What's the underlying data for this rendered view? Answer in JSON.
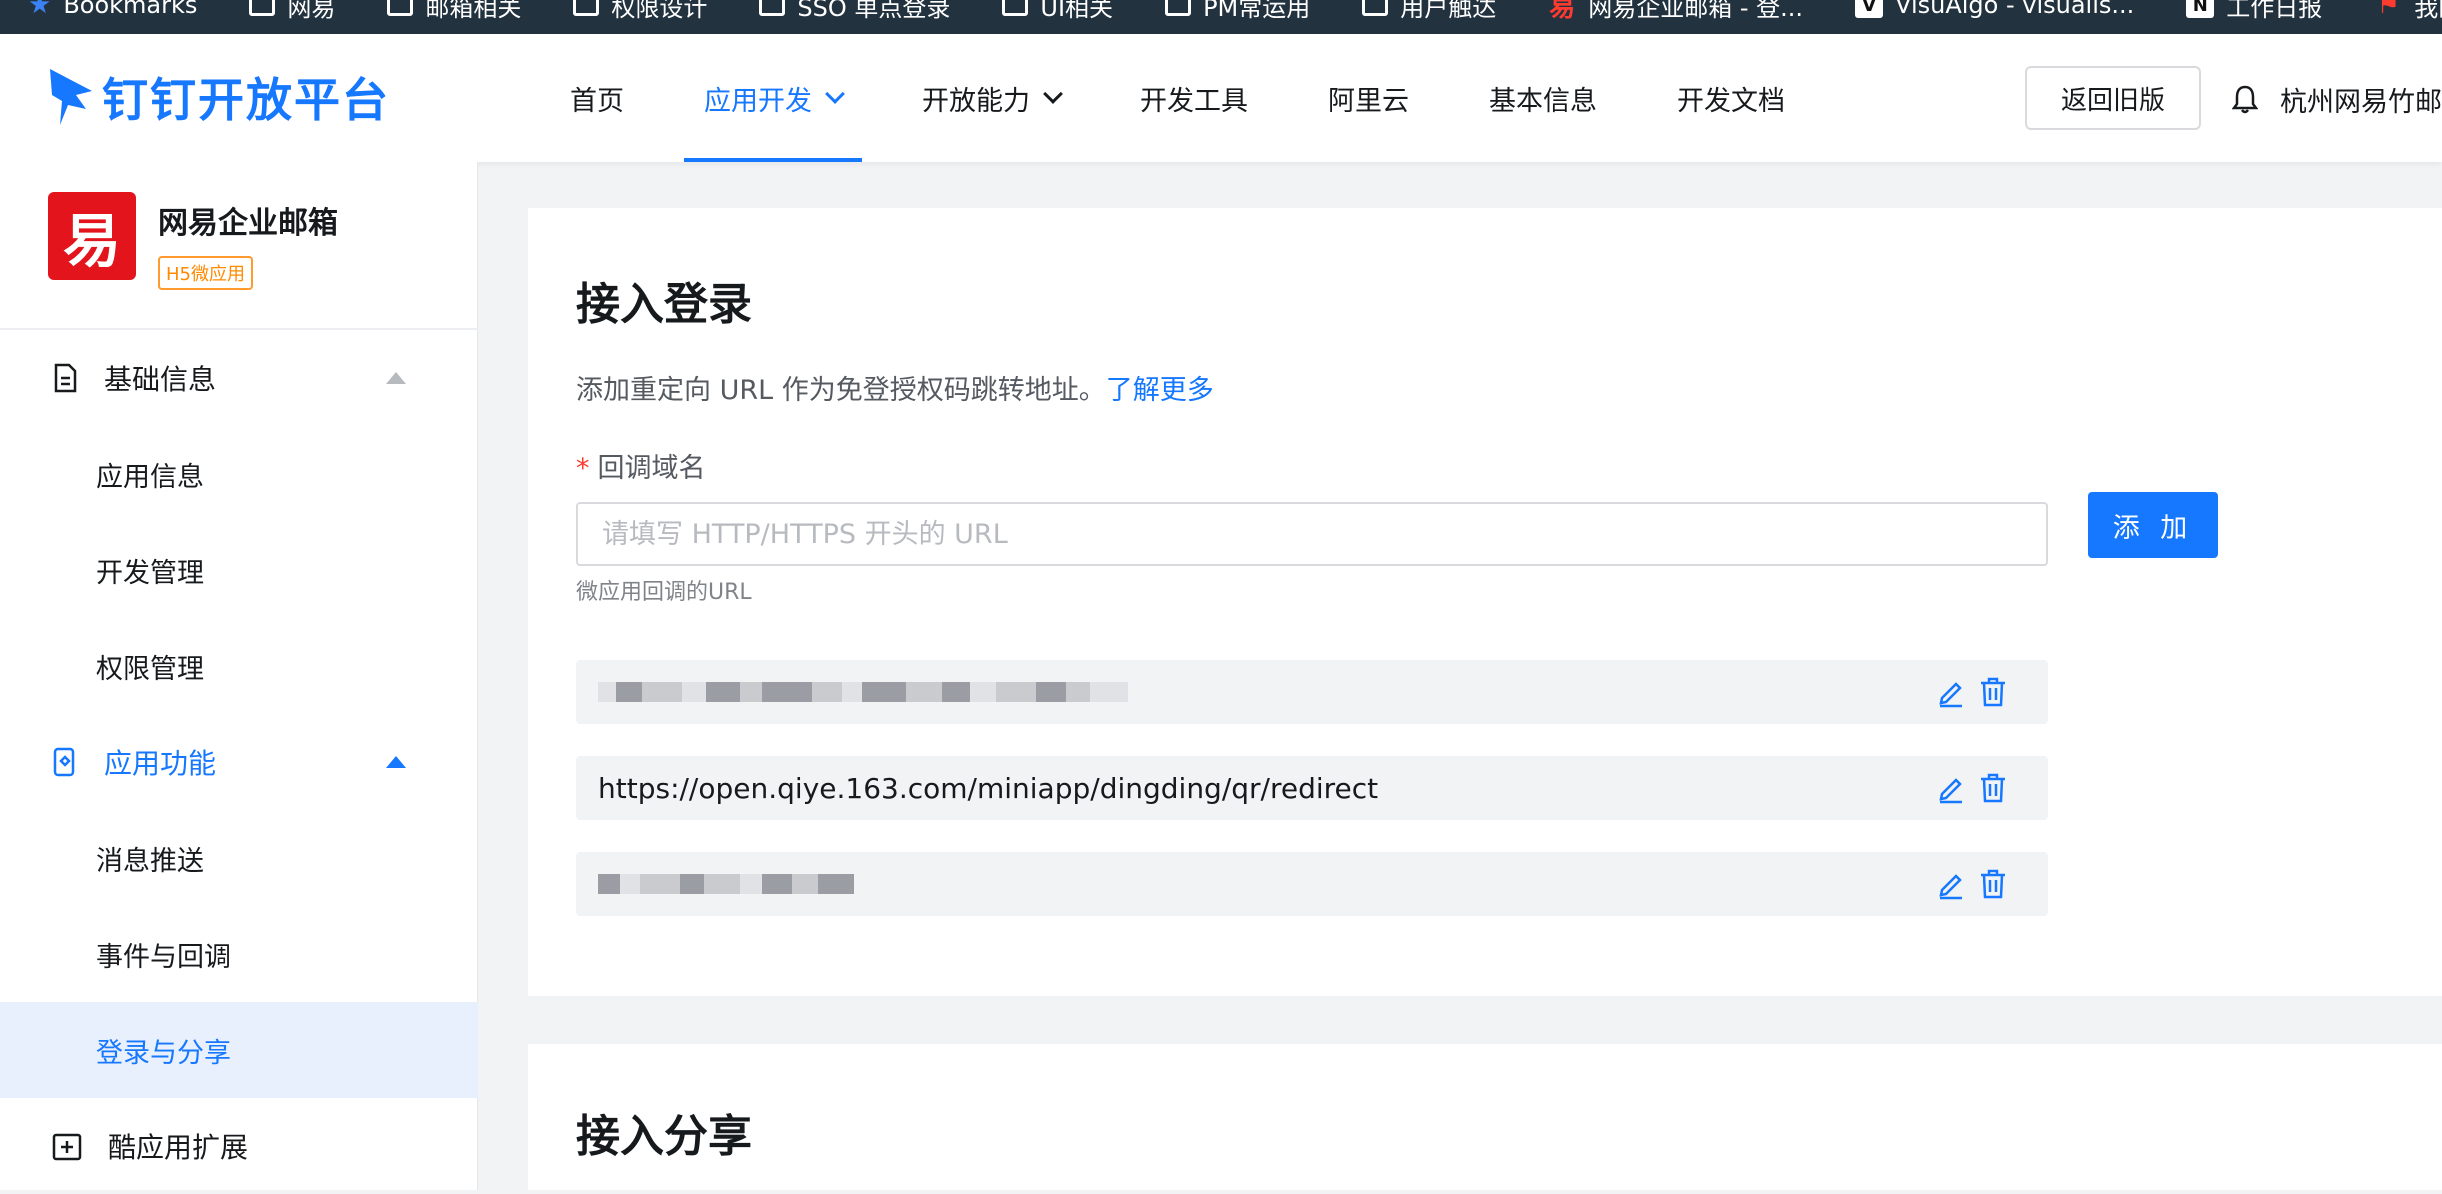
{
  "bookmarks": [
    {
      "icon": "star-icon",
      "label": "Bookmarks"
    },
    {
      "icon": "folder-icon",
      "label": "网易"
    },
    {
      "icon": "folder-icon",
      "label": "邮箱相关"
    },
    {
      "icon": "folder-icon",
      "label": "权限设计"
    },
    {
      "icon": "folder-icon",
      "label": "SSO 单点登录"
    },
    {
      "icon": "folder-icon",
      "label": "UI相关"
    },
    {
      "icon": "folder-icon",
      "label": "PM常运用"
    },
    {
      "icon": "folder-icon",
      "label": "用户触达"
    },
    {
      "icon": "netease-logo-icon",
      "label": "网易企业邮箱 - 登..."
    },
    {
      "icon": "visualgo-logo-icon",
      "label": "VisuAlgo - visualis..."
    },
    {
      "icon": "notion-logo-icon",
      "label": "工作日报"
    },
    {
      "icon": "flag-icon",
      "label": "我的Notion"
    }
  ],
  "header": {
    "brand": "钉钉开放平台",
    "nav": [
      {
        "label": "首页",
        "active": false,
        "dropdown": false
      },
      {
        "label": "应用开发",
        "active": true,
        "dropdown": true
      },
      {
        "label": "开放能力",
        "active": false,
        "dropdown": true
      },
      {
        "label": "开发工具",
        "active": false,
        "dropdown": false
      },
      {
        "label": "阿里云",
        "active": false,
        "dropdown": false
      },
      {
        "label": "基本信息",
        "active": false,
        "dropdown": false
      },
      {
        "label": "开发文档",
        "active": false,
        "dropdown": false
      }
    ],
    "old_version_button": "返回旧版",
    "org_name": "杭州网易竹邮"
  },
  "sidebar": {
    "app_logo_text": "易",
    "app_name": "网易企业邮箱",
    "app_tag": "H5微应用",
    "groups": [
      {
        "label": "基础信息",
        "icon": "document-icon",
        "active": false,
        "items": [
          "应用信息",
          "开发管理",
          "权限管理"
        ]
      },
      {
        "label": "应用功能",
        "icon": "app-feature-icon",
        "active": true,
        "items": [
          "消息推送",
          "事件与回调",
          "登录与分享"
        ]
      }
    ],
    "selected_item": "登录与分享",
    "extra_group": {
      "label": "酷应用扩展",
      "icon": "plus-box-icon"
    }
  },
  "login_section": {
    "title": "接入登录",
    "description": "添加重定向 URL 作为免登授权码跳转地址。",
    "learn_more": "了解更多",
    "required_mark": "*",
    "field_label": "回调域名",
    "input_placeholder": "请填写 HTTP/HTTPS 开头的 URL",
    "input_value": "",
    "add_button": "添 加",
    "help_text": "微应用回调的URL",
    "urls": [
      {
        "value": "",
        "redacted": true
      },
      {
        "value": "https://open.qiye.163.com/miniapp/dingding/qr/redirect",
        "redacted": false
      },
      {
        "value": "",
        "redacted": true
      }
    ]
  },
  "share_section": {
    "title": "接入分享"
  },
  "colors": {
    "brand_blue": "#1677ff",
    "required_red": "#ff3b30",
    "tag_orange": "#ff8a00",
    "app_logo_red": "#e3141b",
    "selected_bg": "#e8f0fd"
  }
}
